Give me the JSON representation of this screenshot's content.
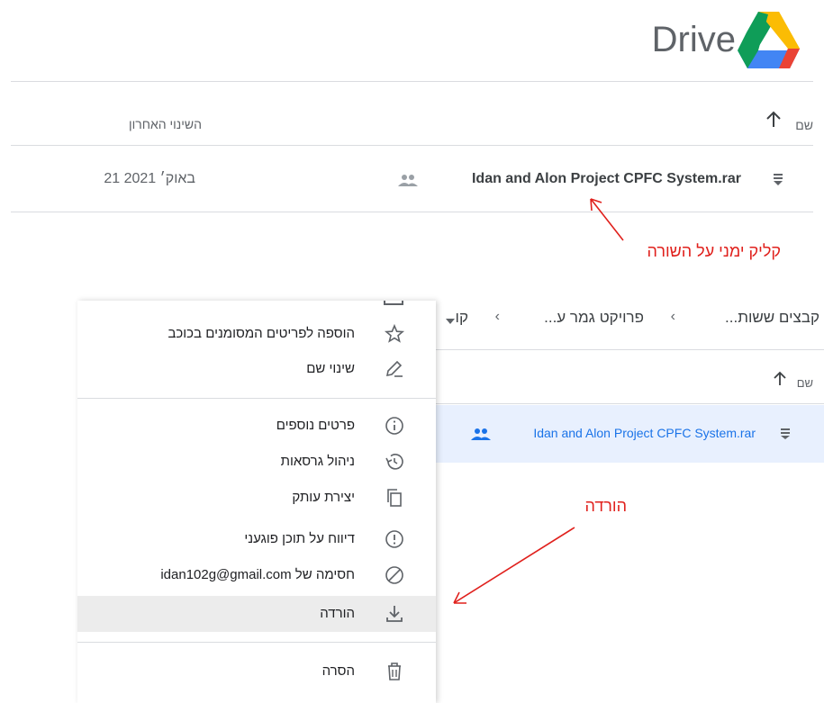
{
  "top": {
    "brand": "Drive",
    "columns": {
      "name": "שם",
      "modified": "השינוי האחרון"
    },
    "file": {
      "name": "Idan and Alon Project CPFC System.rar",
      "modified": "21 באוק׳ 2021"
    },
    "annotation": "קליק ימני על השורה"
  },
  "drive": {
    "breadcrumbs": [
      "קבצים ששות...",
      "פרויקט גמר ע...",
      "קו"
    ],
    "columns": {
      "name": "שם"
    },
    "file": {
      "name": "Idan and Alon Project CPFC System.rar"
    },
    "annotation": "הורדה"
  },
  "menu": {
    "items": [
      {
        "label": "הוספה לפריטים המסומנים בכוכב",
        "icon": "star-icon"
      },
      {
        "label": "שינוי שם",
        "icon": "pencil-icon"
      },
      {
        "label": "פרטים נוספים",
        "icon": "info-icon"
      },
      {
        "label": "ניהול גרסאות",
        "icon": "history-icon"
      },
      {
        "label": "יצירת עותק",
        "icon": "copy-icon"
      },
      {
        "label": "דיווח על תוכן פוגעני",
        "icon": "report-icon"
      },
      {
        "label": "חסימה של idan102g@gmail.com",
        "icon": "block-icon"
      },
      {
        "label": "הורדה",
        "icon": "download-icon",
        "highlighted": true
      },
      {
        "label": "הסרה",
        "icon": "trash-icon"
      }
    ]
  },
  "colors": {
    "annotation": "#e0201c",
    "selection": "#e8f0fe",
    "link": "#1a73e8"
  }
}
